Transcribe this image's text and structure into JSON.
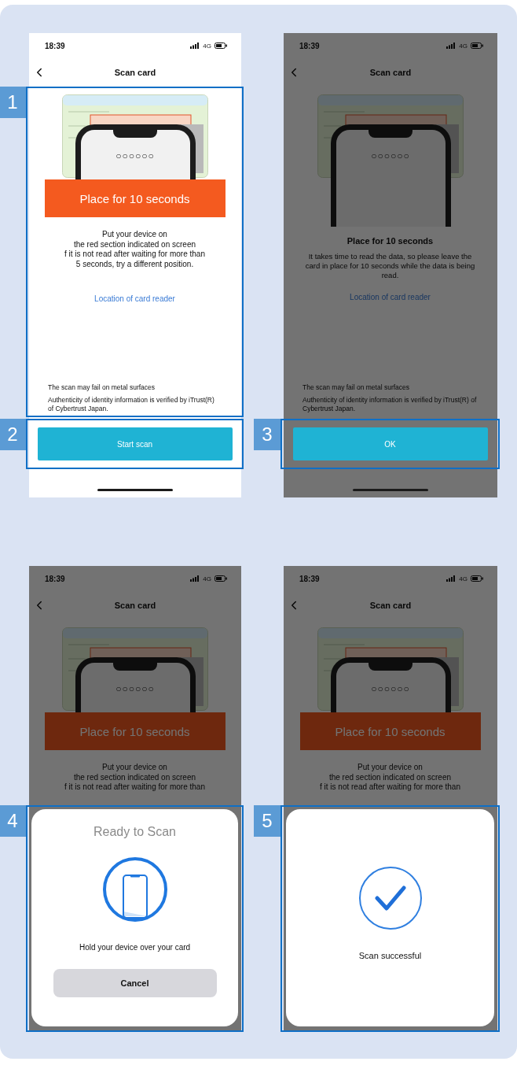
{
  "screens": [
    {
      "status_bar": {
        "time": "18:39",
        "network": "4G"
      },
      "title": "Scan card",
      "dimmed": false,
      "illustration": {
        "code": "○○○○○○"
      },
      "banner": "Place for 10 seconds",
      "instructions": [
        "Put your device on",
        "the red section indicated on screen",
        "f it is not read after waiting for more than",
        "5 seconds, try a different position."
      ],
      "link": "Location of card reader",
      "notes": [
        "The scan may fail on metal surfaces",
        "Authenticity of identity information is verified by iTrust(R) of Cybertrust Japan."
      ],
      "content_callout": "1",
      "button": {
        "label": "Start scan",
        "callout": "2"
      }
    },
    {
      "status_bar": {
        "time": "18:39",
        "network": "4G"
      },
      "title": "Scan card",
      "dimmed": true,
      "illustration": {
        "code": "○○○○○○"
      },
      "dialog": {
        "title": "Place for 10 seconds",
        "message": "It takes time to read the data, so please leave the card in place for 10 seconds while the data is being read."
      },
      "link": "Location of card reader",
      "notes": [
        "The scan may fail on metal surfaces",
        "Authenticity of identity information is verified by iTrust(R) of Cybertrust Japan."
      ],
      "button": {
        "label": "OK",
        "callout": "3"
      }
    },
    {
      "status_bar": {
        "time": "18:39",
        "network": "4G"
      },
      "title": "Scan card",
      "dimmed": true,
      "illustration": {
        "code": "○○○○○○"
      },
      "banner": "Place for 10 seconds",
      "instructions": [
        "Put your device on",
        "the red section indicated on screen",
        "f it is not read after waiting for more than"
      ],
      "sheet": {
        "kind": "ready",
        "title": "Ready to Scan",
        "message": "Hold your device over your card",
        "button": "Cancel",
        "callout": "4"
      }
    },
    {
      "status_bar": {
        "time": "18:39",
        "network": "4G"
      },
      "title": "Scan card",
      "dimmed": true,
      "illustration": {
        "code": "○○○○○○"
      },
      "banner": "Place for 10 seconds",
      "instructions": [
        "Put your device on",
        "the red section indicated on screen",
        "f it is not read after waiting for more than"
      ],
      "sheet": {
        "kind": "success",
        "message": "Scan successful",
        "callout": "5"
      }
    }
  ]
}
